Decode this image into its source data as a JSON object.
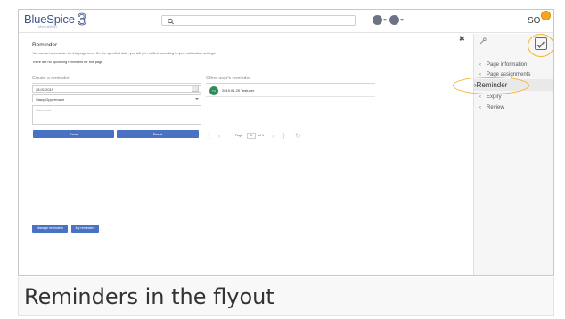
{
  "header": {
    "logo_text": "BlueSpice",
    "logo_sub": "MediaWiki",
    "logo_number": "3",
    "search_placeholder": "",
    "user_initials": "SO"
  },
  "content": {
    "title": "Reminder",
    "description": "You can set a reminder for this page here. On the specified date, you will get notified according to your notification settings.",
    "no_upcoming": "There are no upcoming reminders for this page",
    "create": {
      "heading": "Create a reminder",
      "date_value": "28.01.2019",
      "user_value": "Stacy Oppermann",
      "comment_placeholder": "Comment",
      "save_label": "Save",
      "reset_label": "Reset"
    },
    "others": {
      "heading": "Other user's reminder",
      "avatar_initials": "TU",
      "entry_text": "2019.01.29 Testuser"
    },
    "pager": {
      "page_label": "Page",
      "page_value": "1",
      "of_label": "of 1"
    },
    "manage_label": "Manage reminders",
    "my_reminders_label": "My reminders"
  },
  "flyout": {
    "items": [
      {
        "label": "Page information"
      },
      {
        "label": "Page assignments"
      },
      {
        "label": "Reminder"
      },
      {
        "label": "Expiry"
      },
      {
        "label": "Review"
      }
    ]
  },
  "caption": {
    "text": "Reminders in the flyout"
  },
  "colors": {
    "button_blue": "#4a72c4",
    "highlight_orange": "#f0b437",
    "logo_blue": "#3e5389"
  }
}
